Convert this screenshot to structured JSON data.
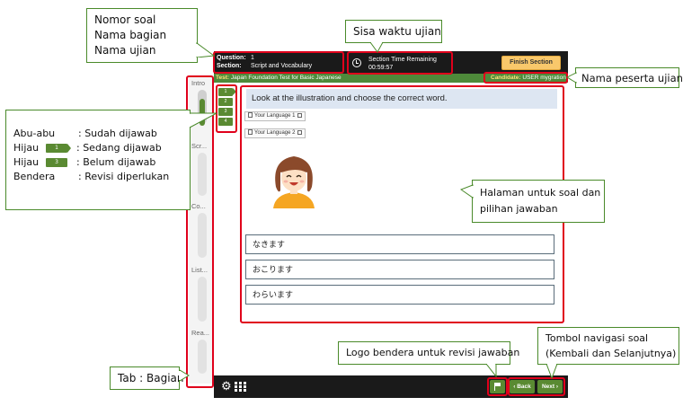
{
  "header": {
    "question_label": "Question:",
    "question_value": "1",
    "section_label": "Section:",
    "section_value": "Script and Vocabulary",
    "timer_label": "Section Time Remaining",
    "timer_value": "00:59:57",
    "finish_label": "Finish Section",
    "test_label": "Test:",
    "test_value": "Japan Foundation Test for Basic Japanese",
    "candidate_label": "Candidate:",
    "candidate_value": "USER mygration"
  },
  "tabs": [
    "Intro",
    "Scr...",
    "Co...",
    "List...",
    "Rea..."
  ],
  "question_nav": [
    "1",
    "2",
    "3",
    "4"
  ],
  "content": {
    "instruction": "Look at the illustration and choose the correct word.",
    "lang_links": [
      "Your Language 1",
      "Your Language 2"
    ],
    "choices": [
      "なきます",
      "おこります",
      "わらいます"
    ]
  },
  "footer": {
    "back_label": "Back",
    "next_label": "Next"
  },
  "callouts": {
    "question_info": [
      "Nomor soal",
      "Nama bagian",
      "Nama ujian"
    ],
    "timer": "Sisa waktu ujian",
    "candidate": "Nama peserta ujian",
    "content_area": [
      "Halaman untuk soal dan",
      "pilihan jawaban"
    ],
    "legend": [
      {
        "key": "Abu-abu",
        "chip": "",
        "text": ": Sudah dijawab"
      },
      {
        "key": "Hijau",
        "chip": "1",
        "text": ": Sedang dijawab"
      },
      {
        "key": "Hijau",
        "chip": "3",
        "text": ": Belum dijawab"
      },
      {
        "key": "Bendera",
        "chip": "",
        "text": ": Revisi diperlukan"
      }
    ],
    "flag": "Logo bendera untuk revisi jawaban",
    "nav": [
      "Tombol navigasi soal",
      "(Kembali dan Selanjutnya)"
    ],
    "tab": "Tab : Bagian"
  },
  "colors": {
    "accent_green": "#5a8a32",
    "highlight_red": "#e0001b",
    "finish_button": "#f9c86b",
    "test_bar": "#4e8a3a"
  }
}
